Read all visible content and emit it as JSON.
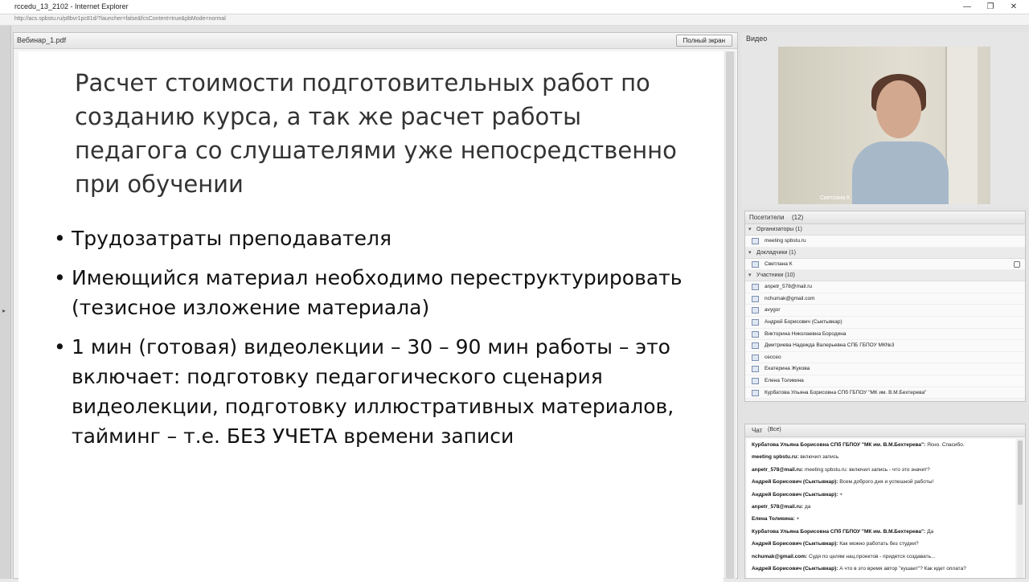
{
  "window": {
    "title": "rccedu_13_2102 - Internet Explorer",
    "url": "http://acs.spbstu.ru/p8bvr1pc81d/?launcher=false&fcsContent=true&pbMode=normal",
    "minimize_icon": "minimize-icon",
    "maximize_icon": "maximize-icon",
    "close_icon": "close-icon"
  },
  "document_pod": {
    "filename": "Вебинар_1.pdf",
    "fullscreen_label": "Полный экран",
    "slide": {
      "title": "Расчет стоимости подготовительных работ по созданию курса, а так же расчет работы педагога со слушателями уже непосредственно при обучении",
      "bullets": [
        "Трудозатраты преподавателя",
        "Имеющийся материал необходимо переструктурировать (тезисное изложение материала)",
        "1 мин (готовая) видеолекции – 30 – 90 мин работы – это включает: подготовку педагогического сценария видеолекции, подготовку иллюстративных материалов, тайминг – т.е. БЕЗ УЧЕТА времени записи"
      ]
    }
  },
  "video_pod": {
    "title": "Видео",
    "speaker_label": "Светлана К"
  },
  "attendees_pod": {
    "title": "Посетители",
    "count": "(12)",
    "groups": [
      {
        "label": "Организаторы (1)",
        "members": [
          "meeting spbstu.ru"
        ]
      },
      {
        "label": "Докладчики (1)",
        "members": [
          "Светлана К"
        ]
      },
      {
        "label": "Участники (10)",
        "members": [
          "anpetr_578@mail.ru",
          "nchumak@gmail.com",
          "avygor",
          "Андрей Борисович (Сыктывкар)",
          "Викторина Николаевна Бородина",
          "Дмитриева Надежда Валерьевна СПБ ГБПОУ МК№3",
          "cecceo",
          "Екатерина Жукова",
          "Елена Толикина",
          "Курбатова Ульяна Борисовна СПб ГБПОУ \"МК им. В.М.Бехтерева\""
        ]
      }
    ]
  },
  "chat_pod": {
    "title": "Чат",
    "scope": "(Все)",
    "messages": [
      {
        "author": "Курбатова Ульяна Борисовна СПб ГБПОУ \"МК им. В.М.Бехтерева\":",
        "text": "Ясно. Спасибо."
      },
      {
        "author": "meeting spbstu.ru:",
        "text": "включил запись"
      },
      {
        "author": "anpetr_578@mail.ru:",
        "text": "meeting spbstu.ru: включил запись - что это значит?"
      },
      {
        "author": "Андрей Борисович (Сыктывкар):",
        "text": "Всем доброго дня и успешной работы!"
      },
      {
        "author": "Андрей Борисович (Сыктывкар):",
        "text": "+"
      },
      {
        "author": "anpetr_578@mail.ru:",
        "text": "да"
      },
      {
        "author": "Елена Толикина:",
        "text": "+"
      },
      {
        "author": "Курбатова Ульяна Борисовна СПб ГБПОУ \"МК им. В.М.Бехтерева\":",
        "text": "Да"
      },
      {
        "author": "Андрей Борисович (Сыктывкар):",
        "text": "Как можно работать без студии?"
      },
      {
        "author": "nchumak@gmail.com:",
        "text": "Судя по целям нац.проектов - придется создавать..."
      },
      {
        "author": "Андрей Борисович (Сыктывкар):",
        "text": "А что в это время автор \"кушает\"? Как идет оплата?"
      }
    ]
  }
}
